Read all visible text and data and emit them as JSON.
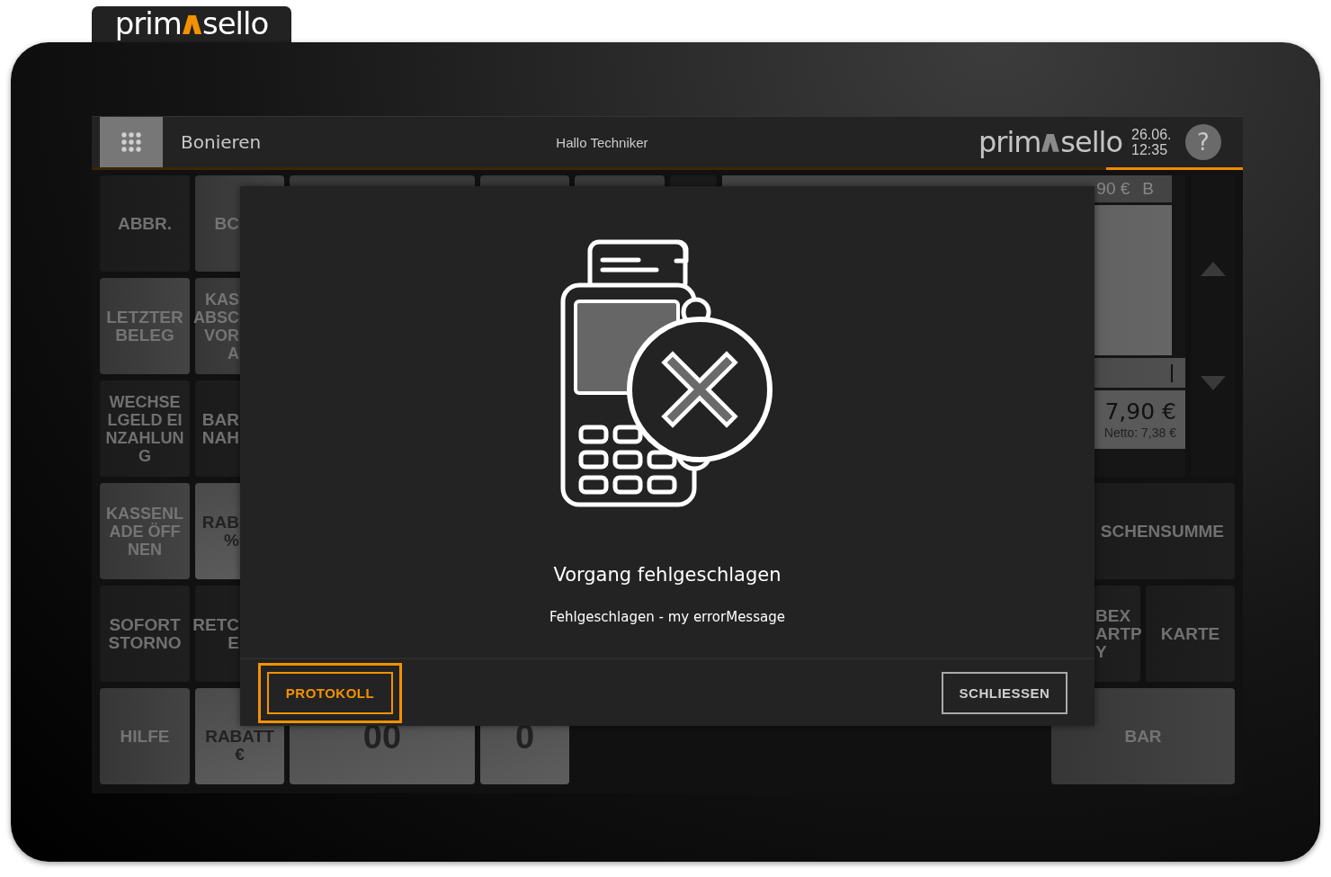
{
  "brand_tab": {
    "logo_left": "prim",
    "logo_right": "sello"
  },
  "header": {
    "title": "Bonieren",
    "greeting": "Hallo Techniker",
    "logo_left": "prim",
    "logo_right": "sello",
    "date": "26.06.",
    "time": "12:35",
    "help": "?"
  },
  "keys": [
    {
      "label": "ABBR.",
      "kind": "dark"
    },
    {
      "label": "BC",
      "kind": "mid"
    },
    {
      "label": "LETZTER BELEG",
      "kind": "mid"
    },
    {
      "label": "KAS ABSC VOR A",
      "kind": "mid"
    },
    {
      "label": "WECHSELGELD EINZAHLUNG",
      "kind": "dark"
    },
    {
      "label": "BAR NAH",
      "kind": "dark"
    },
    {
      "label": "KASSENLADE ÖFFNEN",
      "kind": "mid"
    },
    {
      "label": "RAB %",
      "kind": "light"
    },
    {
      "label": "SCHENSUMME",
      "kind": "dark"
    },
    {
      "label": "SOFORT STORNO",
      "kind": "dark"
    },
    {
      "label": "RETC E",
      "kind": "dark"
    },
    {
      "label": "BEX ARTP Y",
      "kind": "dark"
    },
    {
      "label": "KARTE",
      "kind": "dark"
    },
    {
      "label": "HILFE",
      "kind": "mid"
    },
    {
      "label": "RABATT €",
      "kind": "light"
    },
    {
      "label": "00",
      "kind": "light"
    },
    {
      "label": "0",
      "kind": "light"
    },
    {
      "label": "BAR",
      "kind": "mid"
    }
  ],
  "receipt": {
    "line_price": "90 €",
    "line_tax": "B",
    "total": "7,90 €",
    "net": "Netto: 7,38 €"
  },
  "dialog": {
    "title": "Vorgang fehlgeschlagen",
    "message": "Fehlgeschlagen - my errorMessage",
    "buttons": [
      {
        "label": "PROTOKOLL",
        "focused": true
      },
      {
        "label": "SCHLIESSEN",
        "focused": false
      }
    ]
  }
}
